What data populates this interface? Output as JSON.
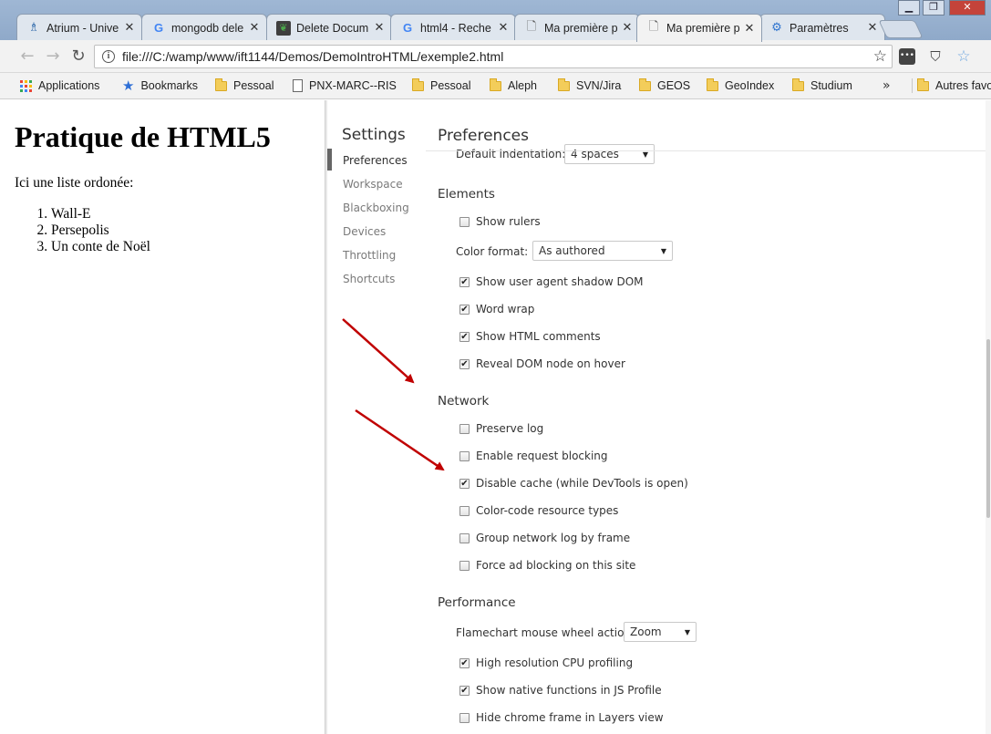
{
  "browser": {
    "tabs": [
      {
        "title": "Atrium - Unive",
        "icon": "atrium-icon",
        "glyph": "♗",
        "cls": "atrium"
      },
      {
        "title": "mongodb dele",
        "icon": "google-icon",
        "glyph": "G",
        "cls": "google"
      },
      {
        "title": "Delete Docum",
        "icon": "mongodb-leaf-icon",
        "glyph": "❦",
        "cls": "mongo"
      },
      {
        "title": "html4 - Reche",
        "icon": "google-icon",
        "glyph": "G",
        "cls": "google"
      },
      {
        "title": "Ma première p",
        "icon": "document-icon",
        "glyph": "🗋",
        "cls": "doc"
      },
      {
        "title": "Ma première p",
        "icon": "document-icon",
        "glyph": "🗋",
        "cls": "doc",
        "active": true
      },
      {
        "title": "Paramètres",
        "icon": "settings-gear-icon",
        "glyph": "⚙",
        "cls": "gear"
      }
    ],
    "close_glyph": "✕",
    "address": {
      "url": "file:///C:/wamp/www/ift1144/Demos/DemoIntroHTML/exemple2.html"
    },
    "bookmarks": [
      {
        "label": "Applications",
        "icon": "apps-grid-icon",
        "kind": "apps"
      },
      {
        "label": "Bookmarks",
        "icon": "star-icon",
        "kind": "star"
      },
      {
        "label": "Pessoal",
        "icon": "folder-icon",
        "kind": "folder"
      },
      {
        "label": "PNX-MARC--RIS",
        "icon": "page-icon",
        "kind": "page"
      },
      {
        "label": "Pessoal",
        "icon": "folder-icon",
        "kind": "folder"
      },
      {
        "label": "Aleph",
        "icon": "folder-icon",
        "kind": "folder"
      },
      {
        "label": "SVN/Jira",
        "icon": "folder-icon",
        "kind": "folder"
      },
      {
        "label": "GEOS",
        "icon": "folder-icon",
        "kind": "folder"
      },
      {
        "label": "GeoIndex",
        "icon": "folder-icon",
        "kind": "folder"
      },
      {
        "label": "Studium",
        "icon": "folder-icon",
        "kind": "folder"
      },
      {
        "label": "Autres favoris",
        "icon": "folder-icon",
        "kind": "folder"
      }
    ],
    "bookmarks_overflow": "»"
  },
  "page": {
    "heading": "Pratique de HTML5",
    "intro": "Ici une liste ordonée:",
    "list": [
      "Wall-E",
      "Persepolis",
      "Un conte de Noël"
    ]
  },
  "devtools": {
    "settings_title": "Settings",
    "nav": [
      "Preferences",
      "Workspace",
      "Blackboxing",
      "Devices",
      "Throttling",
      "Shortcuts"
    ],
    "selected_nav": "Preferences",
    "pane_title": "Preferences",
    "default_indentation": {
      "label": "Default indentation:",
      "value": "4 spaces"
    },
    "elements": {
      "title": "Elements",
      "show_rulers": {
        "label": "Show rulers",
        "checked": false
      },
      "color_format": {
        "label": "Color format:",
        "value": "As authored"
      },
      "options": [
        {
          "label": "Show user agent shadow DOM",
          "checked": true
        },
        {
          "label": "Word wrap",
          "checked": true
        },
        {
          "label": "Show HTML comments",
          "checked": true
        },
        {
          "label": "Reveal DOM node on hover",
          "checked": true
        }
      ]
    },
    "network": {
      "title": "Network",
      "options": [
        {
          "label": "Preserve log",
          "checked": false
        },
        {
          "label": "Enable request blocking",
          "checked": false
        },
        {
          "label": "Disable cache (while DevTools is open)",
          "checked": true
        },
        {
          "label": "Color-code resource types",
          "checked": false
        },
        {
          "label": "Group network log by frame",
          "checked": false
        },
        {
          "label": "Force ad blocking on this site",
          "checked": false
        }
      ]
    },
    "performance": {
      "title": "Performance",
      "flamechart": {
        "label": "Flamechart mouse wheel action:",
        "value": "Zoom"
      },
      "options": [
        {
          "label": "High resolution CPU profiling",
          "checked": true
        },
        {
          "label": "Show native functions in JS Profile",
          "checked": true
        },
        {
          "label": "Hide chrome frame in Layers view",
          "checked": false
        }
      ]
    }
  },
  "colors": {
    "arrow": "#c00000",
    "tabstrip": "#9fb7d4",
    "google_blue": "#4285f4"
  }
}
